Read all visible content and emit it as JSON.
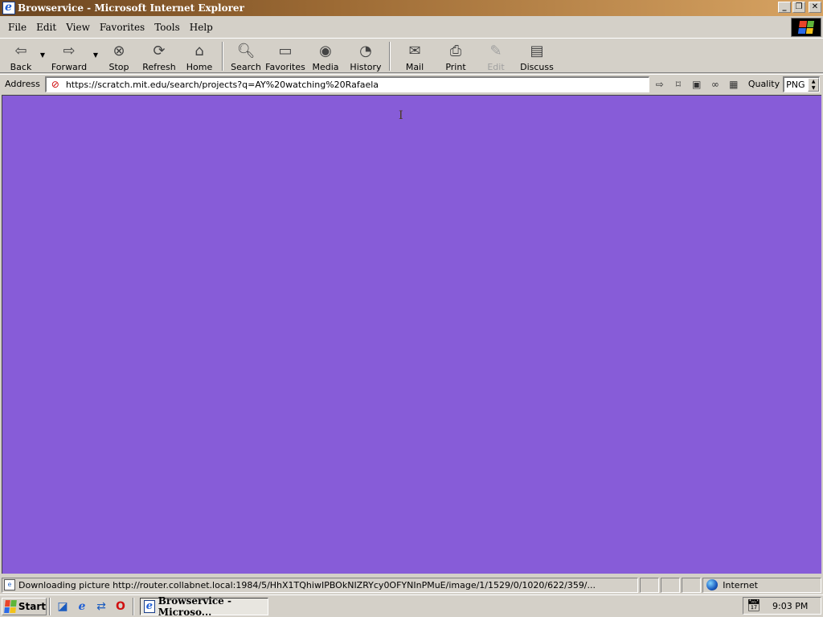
{
  "window": {
    "title": "Browservice - Microsoft Internet Explorer",
    "controls": [
      "minimize",
      "restore",
      "close"
    ]
  },
  "menu": [
    {
      "label": "File"
    },
    {
      "label": "Edit"
    },
    {
      "label": "View"
    },
    {
      "label": "Favorites"
    },
    {
      "label": "Tools"
    },
    {
      "label": "Help"
    }
  ],
  "toolbar": {
    "back": "Back",
    "forward": "Forward",
    "stop": "Stop",
    "refresh": "Refresh",
    "home": "Home",
    "search": "Search",
    "favorites": "Favorites",
    "media": "Media",
    "history": "History",
    "mail": "Mail",
    "print": "Print",
    "edit": "Edit",
    "discuss": "Discuss"
  },
  "address": {
    "label": "Address",
    "url": "https://scratch.mit.edu/search/projects?q=AY%20watching%20Rafaela",
    "quality_label": "Quality",
    "quality_value": "PNG"
  },
  "content": {
    "background": "#875cd8"
  },
  "status": {
    "text": "Downloading picture http://router.collabnet.local:1984/5/HhX1TQhiwIPBOkNIZRYcy0OFYNInPMuE/image/1/1529/0/1020/622/359/...",
    "zone": "Internet"
  },
  "taskbar": {
    "start": "Start",
    "task_button": "Browservice - Microso...",
    "clock": "9:03 PM"
  }
}
